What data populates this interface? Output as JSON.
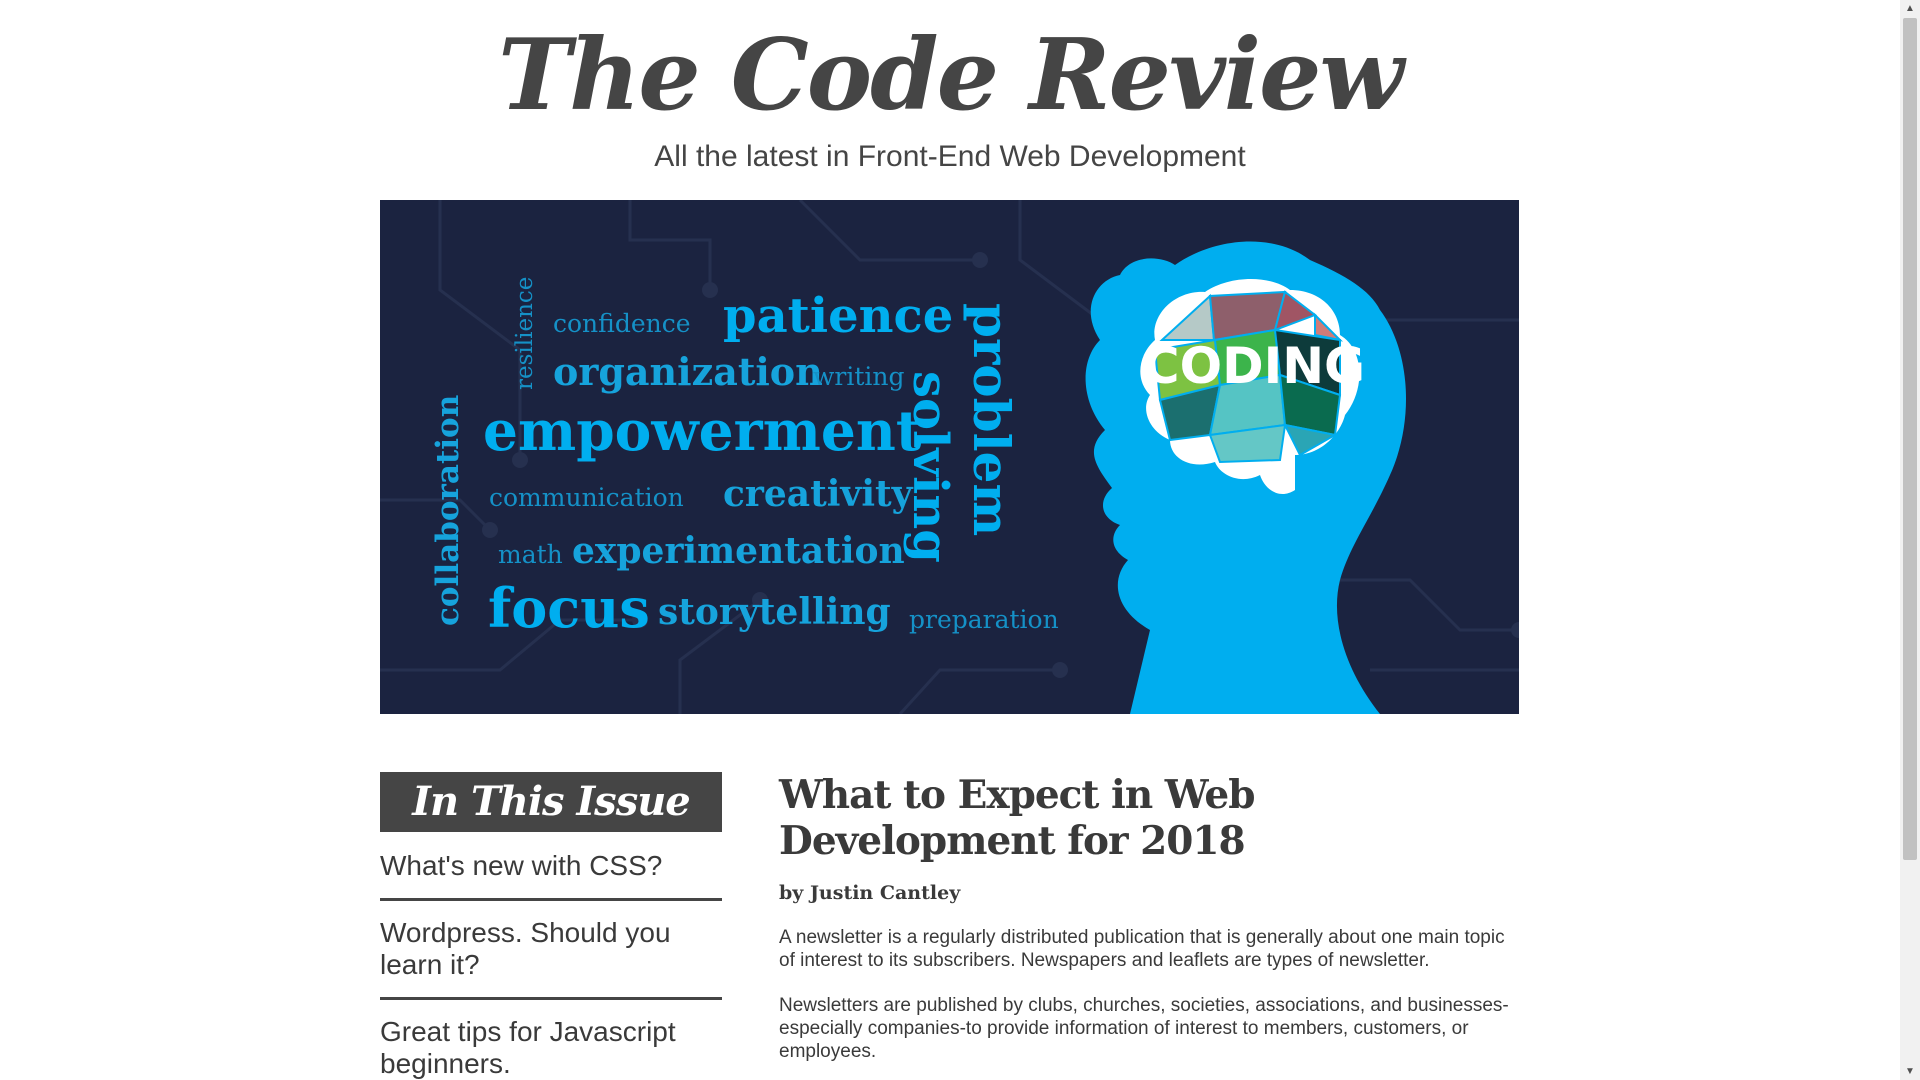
{
  "header": {
    "title": "The Code Review",
    "tagline": "All the latest in Front-End Web Development"
  },
  "hero": {
    "words": {
      "resilience": "resilience",
      "confidence": "confidence",
      "patience": "patience",
      "organization": "organization",
      "writing": "writing",
      "empowerment": "empowerment",
      "collaboration": "collaboration",
      "communication": "communication",
      "creativity": "creativity",
      "math": "math",
      "experimentation": "experimentation",
      "focus": "focus",
      "storytelling": "storytelling",
      "solving": "solving",
      "problem": "problem",
      "preparation": "preparation"
    },
    "brain_label": "CODING",
    "colors": {
      "background": "#1b2340",
      "accent": "#00aeef"
    }
  },
  "sidebar": {
    "heading": "In This Issue",
    "items": [
      "What's new with CSS?",
      "Wordpress. Should you learn it?",
      "Great tips for Javascript beginners."
    ]
  },
  "article": {
    "title": "What to Expect in Web Development for 2018",
    "byline": "by Justin Cantley",
    "paragraphs": [
      "A newsletter is a regularly distributed publication that is generally about one main topic of interest to its subscribers. Newspapers and leaflets are types of newsletter.",
      "Newsletters are published by clubs, churches, societies, associations, and businesses-especially companies-to provide information of interest to members, customers, or employees."
    ]
  },
  "scrollbar": {
    "up_icon": "triangle-up-icon",
    "down_icon": "triangle-down-icon"
  }
}
